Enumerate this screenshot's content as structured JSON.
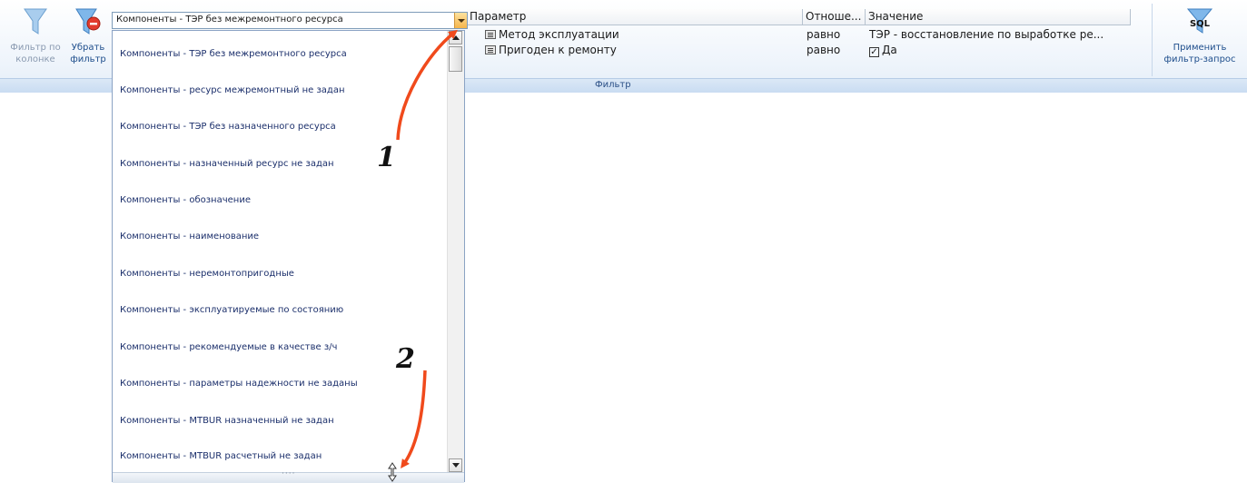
{
  "ribbon": {
    "group_caption": "Фильтр",
    "buttons": [
      {
        "id": "filter-by-column",
        "line1": "Фильтр по",
        "line2": "колонке"
      },
      {
        "id": "remove-filter",
        "line1": "Убрать",
        "line2": "фильтр"
      },
      {
        "id": "apply-query",
        "line1": "Применить",
        "line2": "фильтр-запрос",
        "icon_text": "SQL"
      }
    ]
  },
  "combo": {
    "selected": "Компоненты - ТЭР без межремонтного ресурса"
  },
  "dropdown": {
    "items": [
      "Компоненты - ТЭР без межремонтного ресурса",
      "Компоненты - ресурс межремонтный не задан",
      "Компоненты - ТЭР без назначенного ресурса",
      "Компоненты - назначенный ресурс не задан",
      "Компоненты - обозначение",
      "Компоненты - наименование",
      "Компоненты - неремонтопригодные",
      "Компоненты - эксплуатируемые по состоянию",
      "Компоненты - рекомендуемые в качестве з/ч",
      "Компоненты - параметры надежности не заданы",
      "Компоненты - MTBUR назначенный не задан",
      "Компоненты - MTBUR расчетный не задан"
    ],
    "grip": "····"
  },
  "grid": {
    "headers": [
      "Параметр",
      "Отноше...",
      "Значение"
    ],
    "rows": [
      {
        "param": "Метод эксплуатации",
        "relation": "равно",
        "value": "ТЭР - восстановление по выработке ре..."
      },
      {
        "param": "Пригоден к ремонту",
        "relation": "равно",
        "value": "Да",
        "checked": true
      }
    ]
  },
  "annotations": {
    "one": "1",
    "two": "2"
  },
  "colors": {
    "accent": "#f04a1c",
    "link": "#1b2f6b",
    "ribbon_text": "#1e4e8c"
  }
}
